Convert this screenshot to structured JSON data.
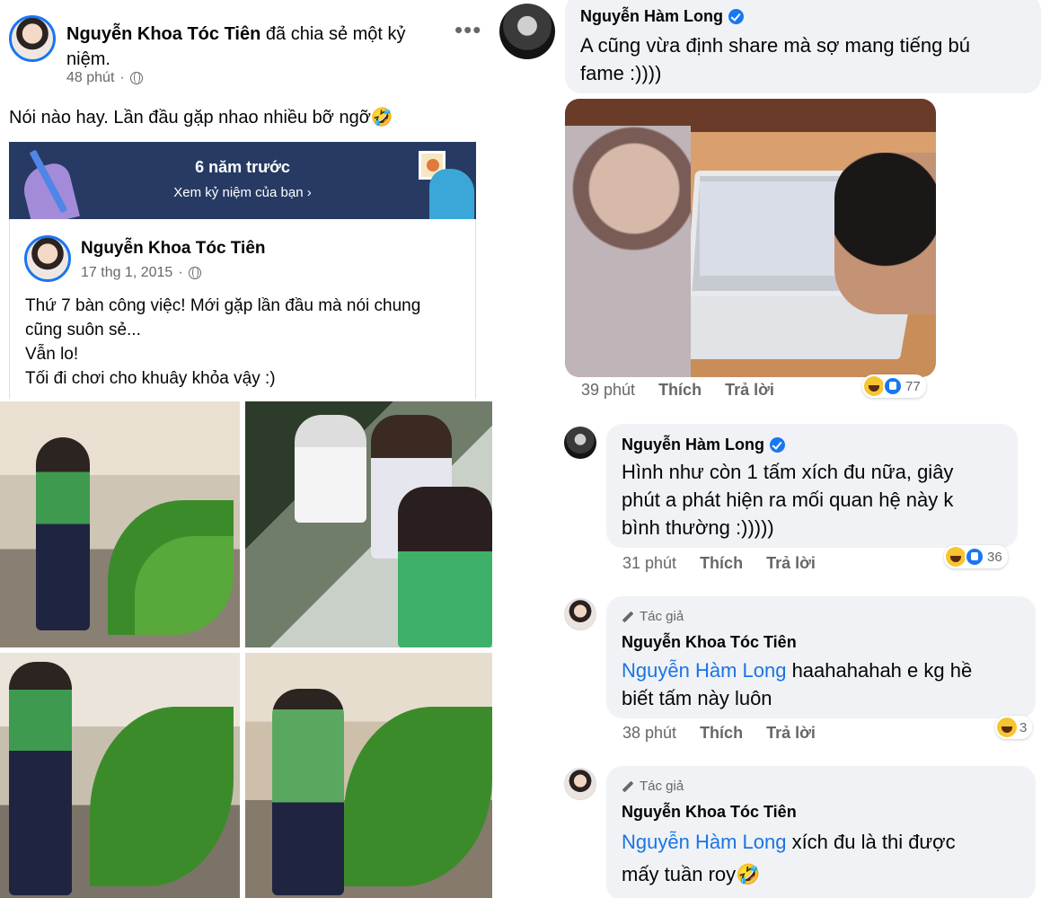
{
  "post": {
    "author": "Nguyễn Khoa Tóc Tiên",
    "action": "đã chia sẻ một kỷ niệm.",
    "time": "48 phút",
    "more_icon": "more-dots-icon",
    "text": "Nói nào hay. Lần đầu gặp nhao nhiều bỡ ngỡ🤣"
  },
  "memory_banner": {
    "title": "6 năm trước",
    "subtitle": "Xem kỷ niệm của bạn ›",
    "bg_color": "#263a63"
  },
  "shared_post": {
    "author": "Nguyễn Khoa Tóc Tiên",
    "date": "17 thg 1, 2015",
    "lines": [
      "Thứ 7 bàn công việc!  Mới gặp lần đầu mà nói chung",
      "cũng suôn sẻ...",
      "Vẫn lo!",
      "Tối đi chơi cho khuây khỏa vậy :)"
    ]
  },
  "comments": [
    {
      "author": "Nguyễn Hàm Long",
      "verified": true,
      "lines": [
        "A cũng vừa định share mà sợ mang tiếng bú",
        "fame :))))"
      ],
      "time": "39 phút",
      "like_label": "Thích",
      "reply_label": "Trả lời",
      "reaction_count": "77"
    },
    {
      "author": "Nguyễn Hàm Long",
      "verified": true,
      "lines": [
        "Hình như còn 1 tấm xích đu nữa, giây",
        "phút a phát hiện ra mối quan hệ này k",
        "bình thường :)))))"
      ],
      "time": "31 phút",
      "like_label": "Thích",
      "reply_label": "Trả lời",
      "reaction_count": "36"
    },
    {
      "author_tag": "Tác giả",
      "author": "Nguyễn Khoa Tóc Tiên",
      "mention": "Nguyễn Hàm Long",
      "line1_rest": " haahahahah e kg hề",
      "line2": "biết tấm này luôn",
      "time": "38 phút",
      "like_label": "Thích",
      "reply_label": "Trả lời",
      "reaction_count": "3"
    },
    {
      "author_tag": "Tác giả",
      "author": "Nguyễn Khoa Tóc Tiên",
      "mention": "Nguyễn Hàm Long",
      "line1_rest": " xích đu là thi được",
      "line2": "mấy tuần roy🤣"
    }
  ],
  "colors": {
    "accent": "#1877f2",
    "mention": "#1b74e4",
    "bubble": "#f0f2f5",
    "muted": "#65676b"
  }
}
